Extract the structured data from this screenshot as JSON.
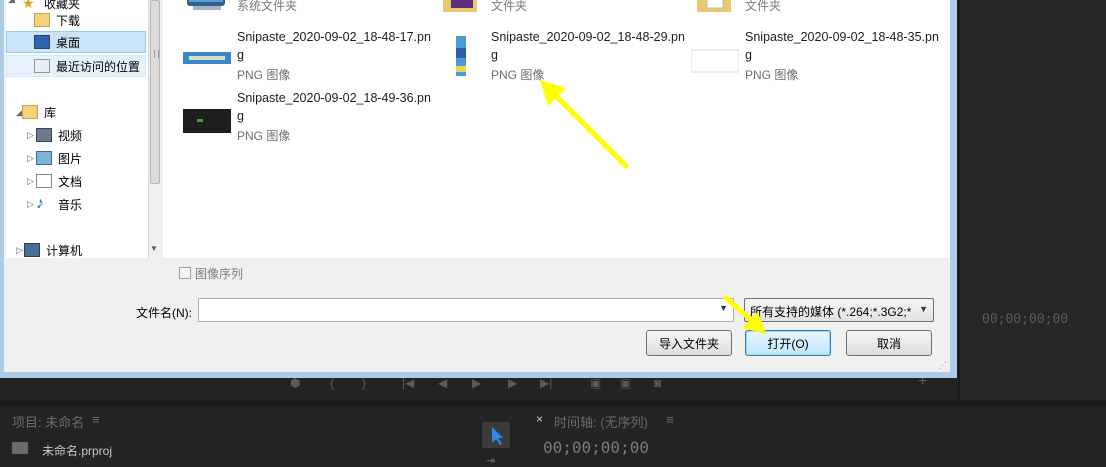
{
  "dialog": {
    "nav": {
      "favorites_label": "收藏夹",
      "downloads": "下载",
      "desktop": "桌面",
      "recent": "最近访问的位置",
      "library": "库",
      "videos": "视频",
      "pictures": "图片",
      "documents": "文档",
      "music": "音乐",
      "computer": "计算机"
    },
    "top_row": [
      {
        "type": "系统文件夹"
      },
      {
        "type": "文件夹"
      },
      {
        "type": "文件夹"
      }
    ],
    "files": [
      {
        "name": "Snipaste_2020-09-02_18-48-17.png",
        "type": "PNG 图像"
      },
      {
        "name": "Snipaste_2020-09-02_18-48-29.png",
        "type": "PNG 图像"
      },
      {
        "name": "Snipaste_2020-09-02_18-48-35.png",
        "type": "PNG 图像"
      },
      {
        "name": "Snipaste_2020-09-02_18-49-36.png",
        "type": "PNG 图像"
      }
    ],
    "image_sequence_label": "图像序列",
    "filename_label": "文件名(N):",
    "filename_value": "",
    "filter_value": "所有支持的媒体 (*.264;*.3G2;*",
    "import_folder_button": "导入文件夹",
    "open_button": "打开(O)",
    "cancel_button": "取消"
  },
  "premiere": {
    "timecode_program": "00;00;00;00",
    "project_panel_title": "项目: 未命名",
    "project_file": "未命名.prproj",
    "timeline_title": "时间轴: (无序列)",
    "timeline_timecode": "00;00;00;00"
  },
  "colors": {
    "annotation_arrow": "#ffff00",
    "dialog_frame": "#aecbe8",
    "selected_nav": "#cce4f7"
  }
}
